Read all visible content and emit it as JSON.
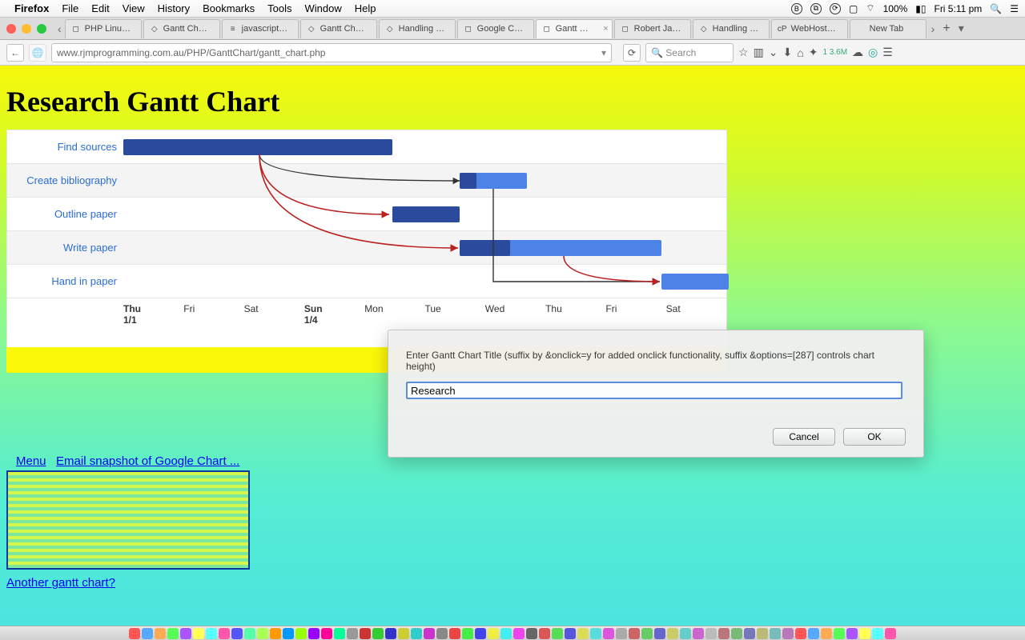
{
  "mac_menu": {
    "app": "Firefox",
    "items": [
      "File",
      "Edit",
      "View",
      "History",
      "Bookmarks",
      "Tools",
      "Window",
      "Help"
    ],
    "battery": "100%",
    "clock": "Fri 5:11 pm"
  },
  "tabs": [
    {
      "label": "PHP Linu…",
      "favicon": "◻"
    },
    {
      "label": "Gantt Ch…",
      "favicon": "◇"
    },
    {
      "label": "javascript…",
      "favicon": "≡"
    },
    {
      "label": "Gantt Ch…",
      "favicon": "◇"
    },
    {
      "label": "Handling …",
      "favicon": "◇"
    },
    {
      "label": "Google C…",
      "favicon": "◻"
    },
    {
      "label": "Gantt …",
      "favicon": "◻",
      "active": true,
      "closeable": true
    },
    {
      "label": "Robert Ja…",
      "favicon": "◻"
    },
    {
      "label": "Handling …",
      "favicon": "◇"
    },
    {
      "label": "WebHost…",
      "favicon": "cP"
    },
    {
      "label": "New Tab",
      "favicon": ""
    }
  ],
  "url": "www.rjmprogramming.com.au/PHP/GanttChart/gantt_chart.php",
  "search_placeholder": "Search",
  "toolbar_badge": "1 3.6M",
  "page": {
    "title": "Research Gantt Chart",
    "menu_link": "Menu",
    "email_link": "Email snapshot of Google Chart ...",
    "another_link": "Another gantt chart?"
  },
  "dialog": {
    "message": "Enter Gantt Chart Title (suffix by &onclick=y for added onclick functionality, suffix &options=[287] controls chart height)",
    "value": "Research",
    "cancel": "Cancel",
    "ok": "OK"
  },
  "chart_data": {
    "type": "gantt",
    "title": "Research Gantt Chart",
    "time_unit": "day",
    "axis_ticks": [
      {
        "label": "Thu",
        "sub": "1/1",
        "bold": true
      },
      {
        "label": "Fri"
      },
      {
        "label": "Sat"
      },
      {
        "label": "Sun",
        "sub": "1/4",
        "bold": true
      },
      {
        "label": "Mon"
      },
      {
        "label": "Tue"
      },
      {
        "label": "Wed"
      },
      {
        "label": "Thu"
      },
      {
        "label": "Fri"
      },
      {
        "label": "Sat"
      }
    ],
    "tasks": [
      {
        "id": "find",
        "name": "Find sources",
        "start": 0,
        "end": 4,
        "pct_complete": 100
      },
      {
        "id": "bib",
        "name": "Create bibliography",
        "start": 5,
        "end": 6,
        "pct_complete": 25
      },
      {
        "id": "outline",
        "name": "Outline paper",
        "start": 4,
        "end": 5,
        "pct_complete": 100
      },
      {
        "id": "write",
        "name": "Write paper",
        "start": 5,
        "end": 8,
        "pct_complete": 25
      },
      {
        "id": "hand",
        "name": "Hand in paper",
        "start": 8,
        "end": 9,
        "pct_complete": 0
      }
    ],
    "dependencies": [
      {
        "from": "find",
        "to": "bib",
        "critical": true
      },
      {
        "from": "find",
        "to": "outline",
        "critical": true
      },
      {
        "from": "find",
        "to": "write",
        "critical": true
      },
      {
        "from": "bib",
        "to": "hand",
        "critical": false
      },
      {
        "from": "write",
        "to": "hand",
        "critical": true
      }
    ],
    "colors": {
      "complete": "#2a4b9b",
      "remaining": "#4d82e6",
      "critical_arrow": "#b22",
      "arrow": "#333"
    }
  }
}
